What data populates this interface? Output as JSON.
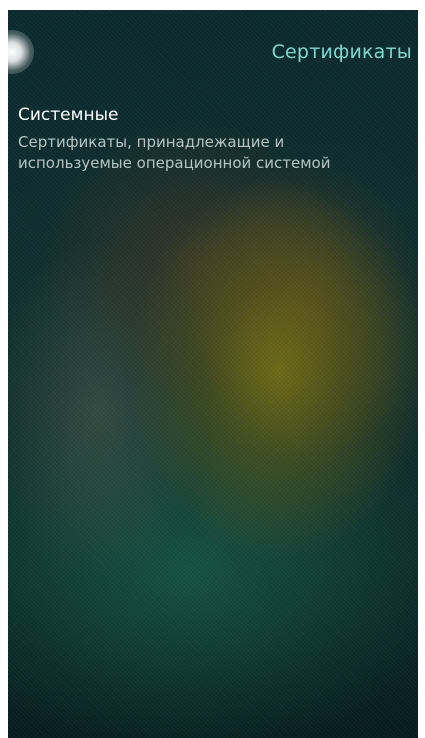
{
  "header": {
    "title": "Сертификаты"
  },
  "list": {
    "items": [
      {
        "title": "Системные",
        "description": "Сертификаты, принадлежащие и используемые операционной системой"
      }
    ]
  },
  "colors": {
    "accent": "#7fd8cf",
    "title_text": "#ffffff",
    "secondary_text": "#b5c4c2",
    "background": "#0f2a2c"
  }
}
